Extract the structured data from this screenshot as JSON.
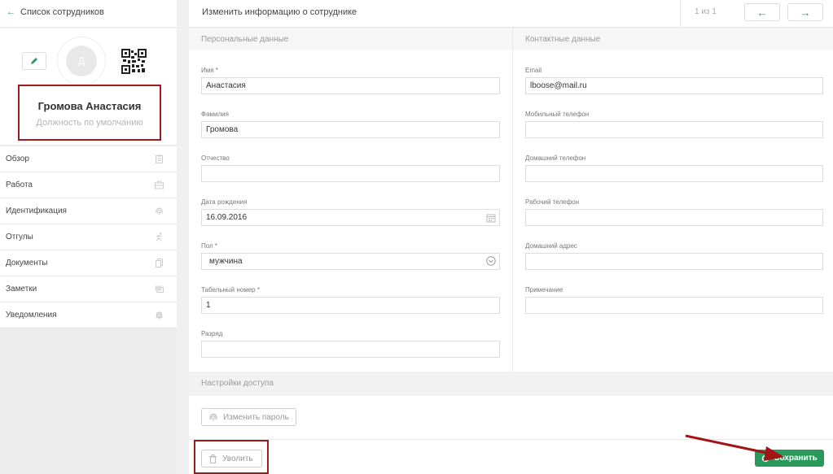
{
  "sidebar": {
    "back_label": "Список сотрудников",
    "back_icon": "arrow-left-icon",
    "profile": {
      "avatar_letter": "Д",
      "name": "Громова Анастасия",
      "role": "Должность по умолчанию"
    },
    "nav": [
      {
        "label": "Обзор",
        "icon": "clipboard-icon"
      },
      {
        "label": "Работа",
        "icon": "briefcase-icon"
      },
      {
        "label": "Идентификация",
        "icon": "fingerprint-icon"
      },
      {
        "label": "Отгулы",
        "icon": "running-icon"
      },
      {
        "label": "Документы",
        "icon": "documents-icon"
      },
      {
        "label": "Заметки",
        "icon": "notes-icon"
      },
      {
        "label": "Уведомления",
        "icon": "bell-icon"
      }
    ]
  },
  "header": {
    "title": "Изменить информацию о сотруднике",
    "pager": "1 из 1",
    "prev_icon": "arrow-left-icon",
    "next_icon": "arrow-right-icon"
  },
  "personal": {
    "heading": "Персональные данные",
    "first_name": {
      "label": "Имя *",
      "value": "Анастасия"
    },
    "last_name": {
      "label": "Фамилия",
      "value": "Громова"
    },
    "middle_name": {
      "label": "Отчество",
      "value": ""
    },
    "birth_date": {
      "label": "Дата рождения",
      "value": "16.09.2016"
    },
    "gender": {
      "label": "Пол *",
      "value": "мужчина"
    },
    "employee_number": {
      "label": "Табельный номер *",
      "value": "1"
    },
    "grade": {
      "label": "Разряд",
      "value": ""
    }
  },
  "contacts": {
    "heading": "Контактные данные",
    "email": {
      "label": "Email",
      "value": "lboose@mail.ru"
    },
    "mobile": {
      "label": "Мобильный телефон",
      "value": ""
    },
    "home_phone": {
      "label": "Домашний телефон",
      "value": ""
    },
    "work_phone": {
      "label": "Рабочий телефон",
      "value": ""
    },
    "address": {
      "label": "Домашний адрес",
      "value": ""
    },
    "note": {
      "label": "Примечание",
      "value": ""
    }
  },
  "access": {
    "heading": "Настройки доступа",
    "change_password": "Изменить пароль",
    "fire": "Уволить",
    "save": "Сохранить"
  },
  "colors": {
    "accent": "#2a9a5c",
    "highlight_box": "#9b1c1c",
    "annotation_arrow": "#a31515"
  }
}
